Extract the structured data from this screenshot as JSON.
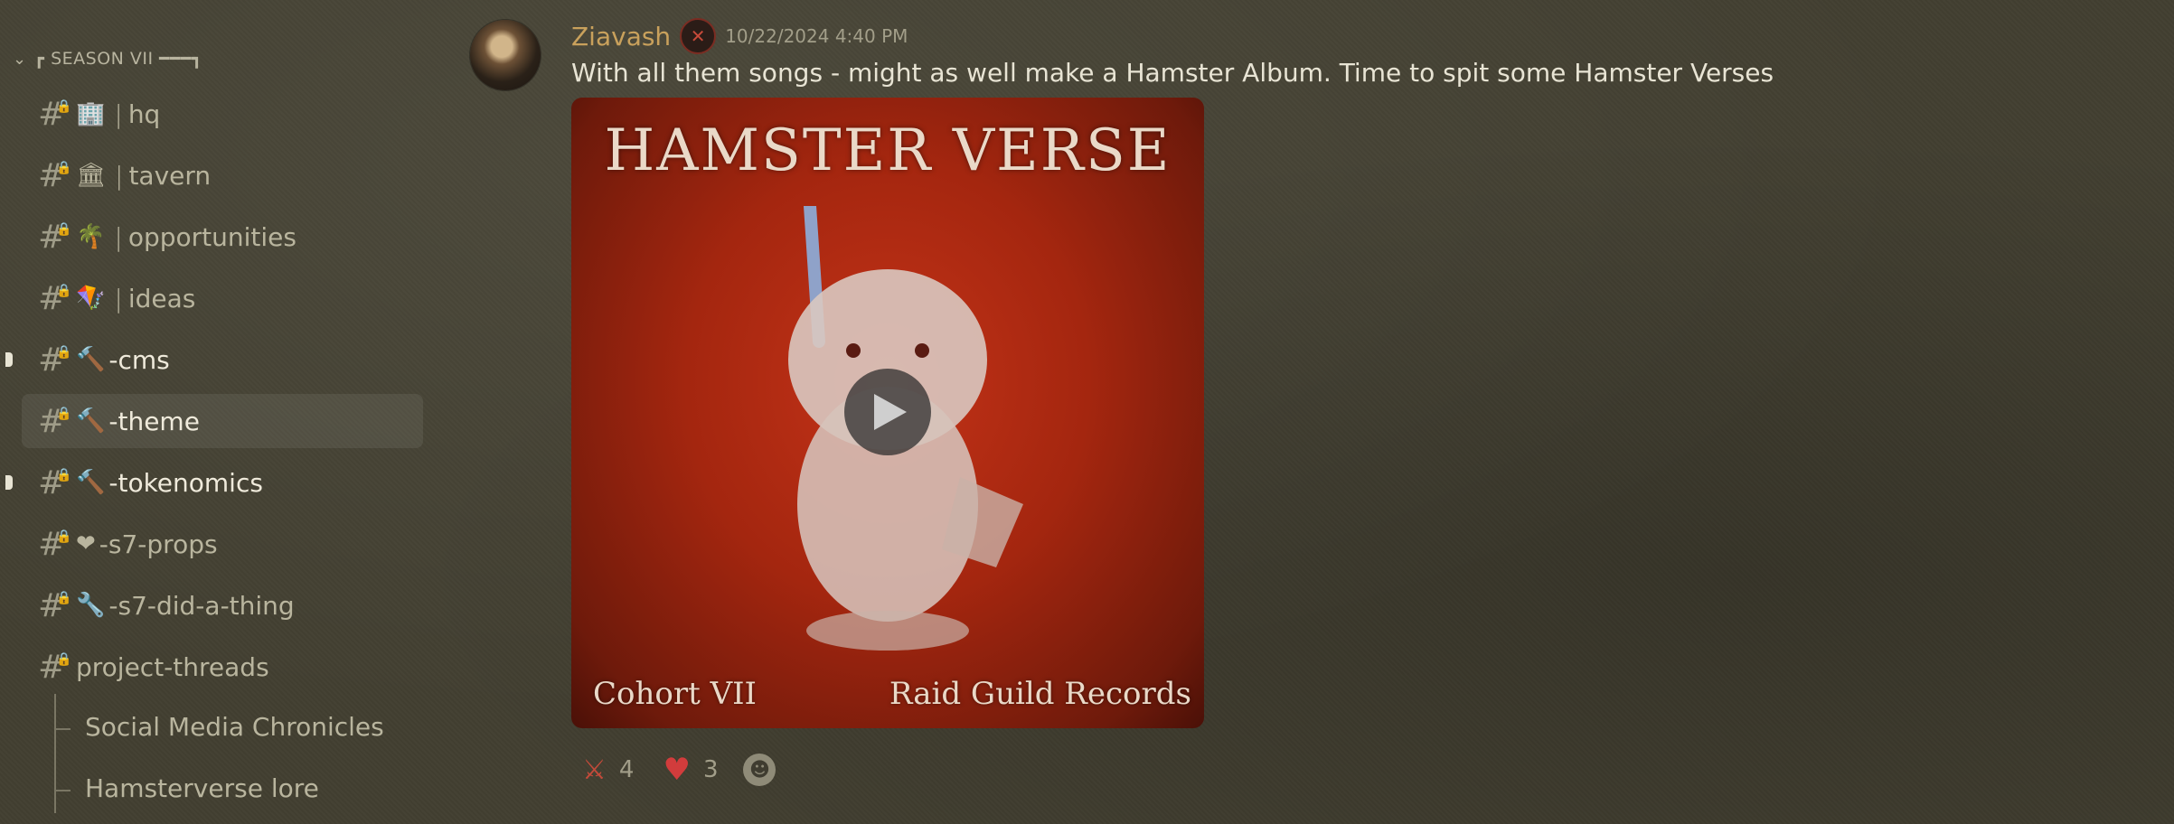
{
  "sidebar": {
    "category": {
      "label": "┏ SEASON VII ━━━┓"
    },
    "channels": [
      {
        "emoji": "🏢",
        "sep": "|",
        "name": "hq",
        "state": "muted"
      },
      {
        "emoji": "🏛",
        "sep": "|",
        "name": "tavern",
        "state": "muted"
      },
      {
        "emoji": "🌴",
        "sep": "|",
        "name": "opportunities",
        "state": "muted"
      },
      {
        "emoji": "🪁",
        "sep": "|",
        "name": "ideas",
        "state": "muted"
      },
      {
        "emoji": "🔨",
        "sep": "",
        "name": "-cms",
        "state": "unread"
      },
      {
        "emoji": "🔨",
        "sep": "",
        "name": "-theme",
        "state": "active"
      },
      {
        "emoji": "🔨",
        "sep": "",
        "name": "-tokenomics",
        "state": "unread"
      },
      {
        "emoji": "❤",
        "sep": "",
        "name": "-s7-props",
        "state": "muted"
      },
      {
        "emoji": "🔧",
        "sep": "",
        "name": "-s7-did-a-thing",
        "state": "muted"
      },
      {
        "emoji": "",
        "sep": "",
        "name": "project-threads",
        "state": "muted"
      }
    ],
    "threads": [
      {
        "name": "Social Media Chronicles"
      },
      {
        "name": "Hamsterverse lore"
      }
    ]
  },
  "message": {
    "username": "Ziavash",
    "timestamp": "10/22/2024 4:40 PM",
    "text": "With all them songs - might as well make a Hamster Album. Time to spit some Hamster Verses",
    "attachment": {
      "title": "HAMSTER VERSE",
      "footer_left": "Cohort VII",
      "footer_right": "Raid Guild Records"
    },
    "reactions": [
      {
        "icon": "crossed-swords-icon",
        "count": "4"
      },
      {
        "icon": "heart-icon",
        "count": "3"
      }
    ]
  }
}
